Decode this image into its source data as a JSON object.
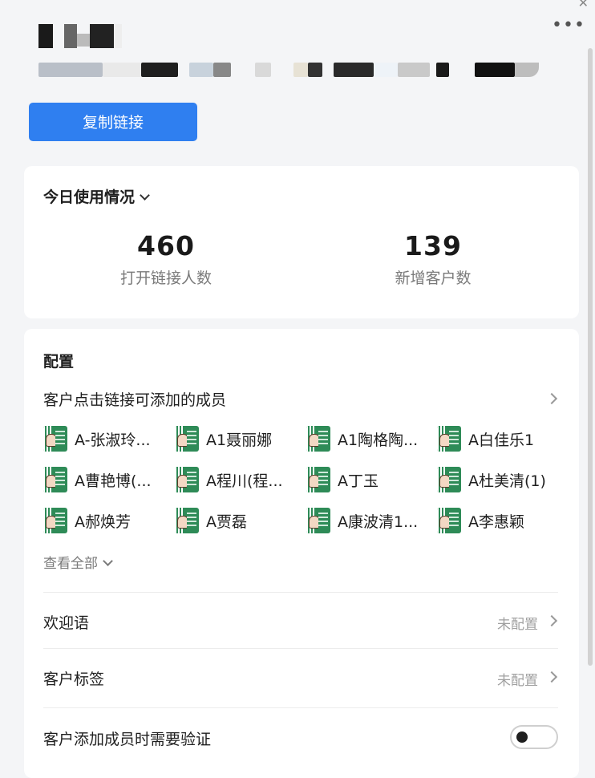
{
  "header": {
    "more_icon": "more-horizontal-icon",
    "close_icon": "close-icon",
    "copy_link_button": "复制链接"
  },
  "usage": {
    "title": "今日使用情况",
    "opened_count": "460",
    "opened_label": "打开链接人数",
    "new_customers_count": "139",
    "new_customers_label": "新增客户数"
  },
  "config": {
    "title": "配置",
    "members_row_label": "客户点击链接可添加的成员",
    "members": [
      {
        "name": "A-张淑玲..."
      },
      {
        "name": "A1聂丽娜"
      },
      {
        "name": "A1陶格陶..."
      },
      {
        "name": "A白佳乐1"
      },
      {
        "name": "A曹艳博(..."
      },
      {
        "name": "A程川(程..."
      },
      {
        "name": "A丁玉"
      },
      {
        "name": "A杜美清(1)"
      },
      {
        "name": "A郝焕芳"
      },
      {
        "name": "A贾磊"
      },
      {
        "name": "A康波清1..."
      },
      {
        "name": "A李惠颖"
      }
    ],
    "view_all": "查看全部",
    "welcome_label": "欢迎语",
    "welcome_status": "未配置",
    "tags_label": "客户标签",
    "tags_status": "未配置",
    "verify_label": "客户添加成员时需要验证",
    "verify_enabled": false
  },
  "colors": {
    "primary_button": "#2f7ff0",
    "background": "#f4f5f7",
    "card": "#ffffff",
    "muted_text": "#7a7a7a"
  }
}
